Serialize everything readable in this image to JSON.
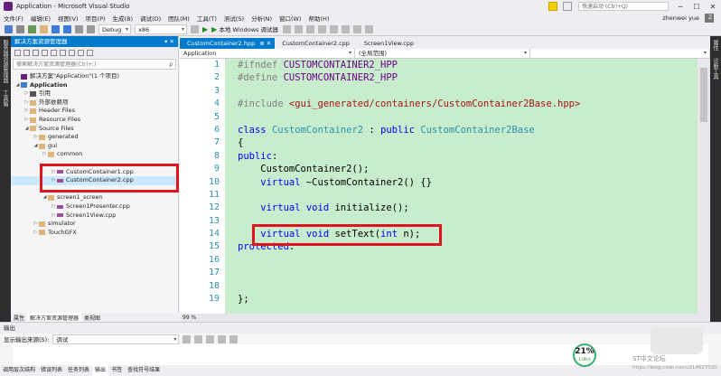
{
  "titlebar": {
    "title": "Application - Microsoft Visual Studio",
    "quick_launch": "快速启动 (Ctrl+Q)",
    "min": "─",
    "max": "☐",
    "close": "✕"
  },
  "menu": {
    "items": [
      "文件(F)",
      "编辑(E)",
      "视图(V)",
      "项目(P)",
      "生成(B)",
      "调试(D)",
      "团队(M)",
      "工具(T)",
      "测试(S)",
      "分析(N)",
      "窗口(W)",
      "帮助(H)"
    ],
    "user": "zhenwei yue",
    "avatar": "Z"
  },
  "toolbar": {
    "config": "Debug",
    "platform": "x86",
    "run_label": "本地 Windows 调试器"
  },
  "left_strip": {
    "items": [
      "服务器资源管理器",
      "工具箱"
    ]
  },
  "right_strip": {
    "items": [
      "属性",
      "诊断工具"
    ]
  },
  "solution": {
    "header": "解决方案资源管理器",
    "pin": "▾ ✕",
    "search_placeholder": "搜索解决方案资源管理器(Ctrl+;)",
    "search_icon": "ρ",
    "tree": [
      {
        "label": "解决方案\"Application\"(1 个项目)",
        "indent": 0,
        "icon": "sln",
        "arrow": ""
      },
      {
        "label": "Application",
        "indent": 0,
        "icon": "proj",
        "arrow": "◢",
        "bold": true
      },
      {
        "label": "引用",
        "indent": 1,
        "icon": "refs",
        "arrow": "▷"
      },
      {
        "label": "外部依赖项",
        "indent": 1,
        "icon": "folder",
        "arrow": "▷"
      },
      {
        "label": "Header Files",
        "indent": 1,
        "icon": "folder",
        "arrow": "▷"
      },
      {
        "label": "Resource Files",
        "indent": 1,
        "icon": "folder",
        "arrow": "▷"
      },
      {
        "label": "Source Files",
        "indent": 1,
        "icon": "folder",
        "arrow": "◢"
      },
      {
        "label": "generated",
        "indent": 2,
        "icon": "folder",
        "arrow": "▷"
      },
      {
        "label": "gui",
        "indent": 2,
        "icon": "folder",
        "arrow": "◢"
      },
      {
        "label": "common",
        "indent": 3,
        "icon": "folder",
        "arrow": "▷"
      },
      {
        "label": "",
        "indent": 3,
        "icon": "",
        "arrow": ""
      },
      {
        "label": "CustomContainer1.cpp",
        "indent": 4,
        "icon": "filecpp",
        "arrow": "▷"
      },
      {
        "label": "CustomContainer2.cpp",
        "indent": 4,
        "icon": "filecpp",
        "arrow": "▷",
        "selected": true
      },
      {
        "label": "",
        "indent": 3,
        "icon": "",
        "arrow": ""
      },
      {
        "label": "screen1_screen",
        "indent": 3,
        "icon": "folder",
        "arrow": "◢"
      },
      {
        "label": "Screen1Presenter.cpp",
        "indent": 4,
        "icon": "filecpp",
        "arrow": "▷"
      },
      {
        "label": "Screen1View.cpp",
        "indent": 4,
        "icon": "filecpp",
        "arrow": "▷"
      },
      {
        "label": "simulator",
        "indent": 2,
        "icon": "folder",
        "arrow": "▷"
      },
      {
        "label": "TouchGFX",
        "indent": 2,
        "icon": "folder",
        "arrow": "▷"
      }
    ],
    "bottom_tabs": [
      "属性",
      "解决方案资源管理器",
      "类视图"
    ]
  },
  "editor": {
    "tabs": [
      {
        "label": "CustomContainer2.hpp",
        "active": true,
        "close": "⊕ ✕"
      },
      {
        "label": "CustomContainer2.cpp",
        "active": false
      },
      {
        "label": "Screen1View.cpp",
        "active": false
      }
    ],
    "nav_project": "Application",
    "nav_scope": "(全局范围)",
    "nav_member": "",
    "zoom": "99 %",
    "lines": [
      {
        "n": "1",
        "tokens": [
          [
            "pp",
            "#ifndef "
          ],
          [
            "mac",
            "CUSTOMCONTAINER2_HPP"
          ]
        ]
      },
      {
        "n": "2",
        "tokens": [
          [
            "pp",
            "#define "
          ],
          [
            "mac",
            "CUSTOMCONTAINER2_HPP"
          ]
        ]
      },
      {
        "n": "3",
        "tokens": []
      },
      {
        "n": "4",
        "tokens": [
          [
            "pp",
            "#include "
          ],
          [
            "st",
            "<gui_generated/containers/CustomContainer2Base.hpp>"
          ]
        ]
      },
      {
        "n": "5",
        "tokens": []
      },
      {
        "n": "6",
        "tokens": [
          [
            "kw",
            "class "
          ],
          [
            "ty",
            "CustomContainer2"
          ],
          [
            "",
            " : "
          ],
          [
            "kw",
            "public "
          ],
          [
            "ty",
            "CustomContainer2Base"
          ]
        ]
      },
      {
        "n": "7",
        "tokens": [
          [
            "",
            "{"
          ]
        ]
      },
      {
        "n": "8",
        "tokens": [
          [
            "kw",
            "public"
          ],
          [
            "",
            ":"
          ]
        ]
      },
      {
        "n": "9",
        "tokens": [
          [
            "",
            "    CustomContainer2();"
          ]
        ]
      },
      {
        "n": "10",
        "tokens": [
          [
            "kw",
            "    virtual "
          ],
          [
            "",
            "~CustomContainer2() {}"
          ]
        ]
      },
      {
        "n": "11",
        "tokens": []
      },
      {
        "n": "12",
        "tokens": [
          [
            "kw",
            "    virtual void "
          ],
          [
            "",
            "initialize();"
          ]
        ]
      },
      {
        "n": "13",
        "tokens": []
      },
      {
        "n": "14",
        "tokens": [
          [
            "kw",
            "    virtual void "
          ],
          [
            "",
            "setText("
          ],
          [
            "kw",
            "int "
          ],
          [
            "",
            "n);"
          ]
        ]
      },
      {
        "n": "15",
        "tokens": [
          [
            "kw",
            "protected"
          ],
          [
            "",
            ":"
          ]
        ]
      },
      {
        "n": "16",
        "tokens": []
      },
      {
        "n": "17",
        "tokens": []
      },
      {
        "n": "18",
        "tokens": []
      },
      {
        "n": "19",
        "tokens": [
          [
            "",
            "};"
          ]
        ]
      }
    ]
  },
  "output": {
    "header": "输出",
    "show_from": "显示输出来源(S):",
    "source": "调试"
  },
  "bottom_tabs": [
    "调用层次结构",
    "错误列表",
    "任务列表",
    "输出",
    "书签",
    "查找符号结果"
  ],
  "memory": {
    "percent": "21%",
    "rate": "1.0K/s"
  },
  "watermark": {
    "text": "ST中文论坛",
    "url": "https://blog.csdn.net/u014627020"
  },
  "colors": {
    "accent": "#007acc",
    "highlight": "#e0141e",
    "code_bg": "#c7edcc"
  }
}
